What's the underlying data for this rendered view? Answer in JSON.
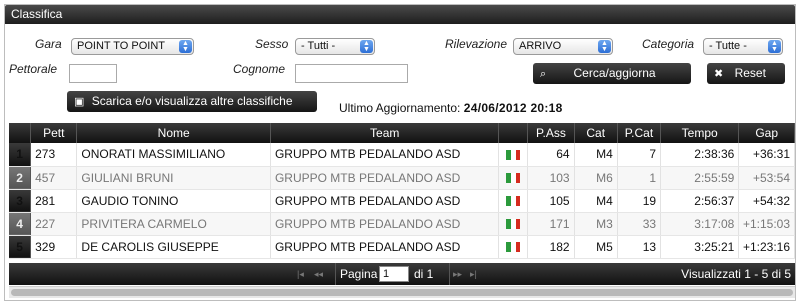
{
  "panel": {
    "title": "Classifica"
  },
  "filters": {
    "gara_label": "Gara",
    "gara_value": "POINT TO POINT",
    "sesso_label": "Sesso",
    "sesso_value": "- Tutti -",
    "rilevazione_label": "Rilevazione",
    "rilevazione_value": "ARRIVO",
    "categoria_label": "Categoria",
    "categoria_value": "- Tutte -",
    "pettorale_label": "Pettorale",
    "pettorale_value": "",
    "cognome_label": "Cognome",
    "cognome_value": ""
  },
  "buttons": {
    "search": "Cerca/aggiorna",
    "reset": "Reset",
    "download": "Scarica e/o visualizza altre classifiche"
  },
  "update": {
    "label": "Ultimo Aggiornamento:",
    "value": "24/06/2012 20:18"
  },
  "table": {
    "headers": [
      "Pett",
      "Nome",
      "Team",
      "",
      "P.Ass",
      "Cat",
      "P.Cat",
      "Tempo",
      "Gap"
    ],
    "rows": [
      {
        "idx": "1",
        "pett": "273",
        "nome": "ONORATI MASSIMILIANO",
        "team": "GRUPPO MTB PEDALANDO ASD",
        "pass": "64",
        "cat": "M4",
        "pcat": "7",
        "tempo": "2:38:36",
        "gap": "+36:31"
      },
      {
        "idx": "2",
        "pett": "457",
        "nome": "GIULIANI BRUNI",
        "team": "GRUPPO MTB PEDALANDO ASD",
        "pass": "103",
        "cat": "M6",
        "pcat": "1",
        "tempo": "2:55:59",
        "gap": "+53:54"
      },
      {
        "idx": "3",
        "pett": "281",
        "nome": "GAUDIO TONINO",
        "team": "GRUPPO MTB PEDALANDO ASD",
        "pass": "105",
        "cat": "M4",
        "pcat": "19",
        "tempo": "2:56:37",
        "gap": "+54:32"
      },
      {
        "idx": "4",
        "pett": "227",
        "nome": "PRIVITERA CARMELO",
        "team": "GRUPPO MTB PEDALANDO ASD",
        "pass": "171",
        "cat": "M3",
        "pcat": "33",
        "tempo": "3:17:08",
        "gap": "+1:15:03"
      },
      {
        "idx": "5",
        "pett": "329",
        "nome": "DE CAROLIS GIUSEPPE",
        "team": "GRUPPO MTB PEDALANDO ASD",
        "pass": "182",
        "cat": "M5",
        "pcat": "13",
        "tempo": "3:25:21",
        "gap": "+1:23:16"
      }
    ]
  },
  "pager": {
    "first": "|◂",
    "prev": "◂◂",
    "page_label": "Pagina",
    "page_value": "1",
    "of_label": "di 1",
    "next": "▸▸",
    "last": "▸|",
    "summary": "Visualizzati 1 - 5 di 5"
  },
  "icons": {
    "search": "search-icon",
    "reset": "close-icon",
    "download": "download-icon",
    "flag": "italy-flag-icon"
  },
  "colors": {
    "header_bg": "#1e1e1e",
    "select_arrow": "#2d6fd6",
    "flag_green": "#2b9a3c",
    "flag_red": "#d52b1e"
  }
}
